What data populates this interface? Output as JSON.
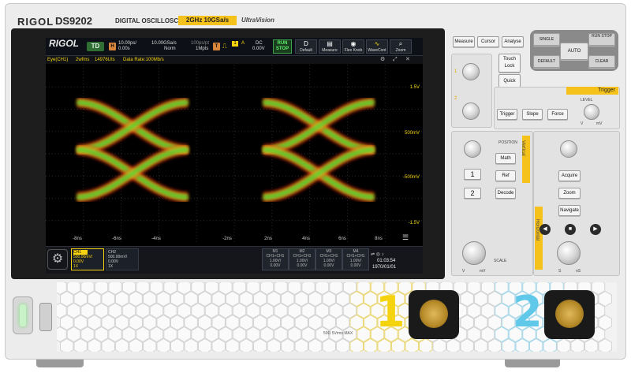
{
  "device": {
    "brand": "RIGOL",
    "model": "DS9202",
    "model_prefix": "DS",
    "model_number": "9202",
    "subtitle": "DIGITAL OSCILLOSCOPE",
    "spec": "2GHz  10GSa/s",
    "tech_logo": "UltraVision"
  },
  "toolbar": {
    "logo": "RIGOL",
    "mode": "TD",
    "h_label": "H",
    "h_scale": "10.00ps/",
    "h_offset": "0.00s",
    "sa_rate": "10.00GSa/s",
    "acq_mode": "Norm",
    "sample_spacing": "100ps/pt",
    "mem_depth": "1Mpts",
    "t_label": "T",
    "trig_ch": "1",
    "trig_type": "A",
    "coupling": "DC",
    "trig_level": "0.00V",
    "run_stop": "RUN STOP",
    "default_label": "Default",
    "measure_label": "Measure",
    "flex_label": "Flex Knob",
    "wavecont_label": "WaveCont",
    "zoom_label": "Zoom"
  },
  "status": {
    "title": "Eye(CH1)",
    "wfms": "2wfms",
    "uis": "14976UIs",
    "data_rate": "Data Rate:100Mb/s"
  },
  "eye_diagram": {
    "y_labels": [
      "1.5V",
      "500mV",
      "-500mV",
      "-1.5V"
    ],
    "x_labels": [
      "-8ns",
      "-6ns",
      "-4ns",
      "-2ns",
      "2ns",
      "4ns",
      "6ns",
      "8ns"
    ]
  },
  "channels": {
    "ch1_name": "CH1",
    "ch1_scale": "500.00mV/",
    "ch1_offset": "0.00V",
    "ch1_imp": "1X",
    "ch2_name": "CH2",
    "ch2_scale": "500.00mV/",
    "ch2_offset": "0.00V",
    "ch2_imp": "1X",
    "math": [
      {
        "name": "M1",
        "expr": "CH1+CH1",
        "scale": "1.00V/",
        "offset": "0.00V"
      },
      {
        "name": "M2",
        "expr": "CH1+CH1",
        "scale": "1.00V/",
        "offset": "0.00V"
      },
      {
        "name": "M3",
        "expr": "CH1+CH1",
        "scale": "1.00V/",
        "offset": "0.00V"
      },
      {
        "name": "M4",
        "expr": "CH1+CH1",
        "scale": "1.00V/",
        "offset": "0.00V"
      }
    ],
    "time": "01:03:54",
    "date": "1970/01/01"
  },
  "panel": {
    "measure": "Measure",
    "cursor": "Cursor",
    "analyse": "Analyse",
    "single": "SINGLE",
    "runstop": "RUN STOP",
    "auto": "AUTO",
    "default": "DEFAULT",
    "clear": "CLEAR",
    "touch_lock": "Touch Lock",
    "quick": "Quick",
    "trigger_section": "Trigger",
    "trigger_btn": "Trigger",
    "slope": "Slope",
    "force": "Force",
    "level_label": "LEVEL",
    "vertical_section": "Vertical",
    "position_label": "POSITION",
    "math": "Math",
    "ref": "Ref",
    "decode": "Decode",
    "ch1_btn": "1",
    "ch2_btn": "2",
    "scale_label": "SCALE",
    "horizontal_section": "Horizontal",
    "acquire": "Acquire",
    "zoom": "Zoom",
    "navigate": "Navigate",
    "unit_v": "V",
    "unit_mv": "mV",
    "unit_s": "S",
    "unit_ns": "nS"
  },
  "front": {
    "ch1_number": "1",
    "ch2_number": "2",
    "input_warning": "50Ω 5Vrms MAX"
  },
  "colors": {
    "screen_bg": "#000000",
    "ch1_yellow": "#f5d40f",
    "ch2_cyan": "#60c8e8",
    "run_green": "#5cf06b",
    "trigger_yellow": "#f5c21b"
  }
}
